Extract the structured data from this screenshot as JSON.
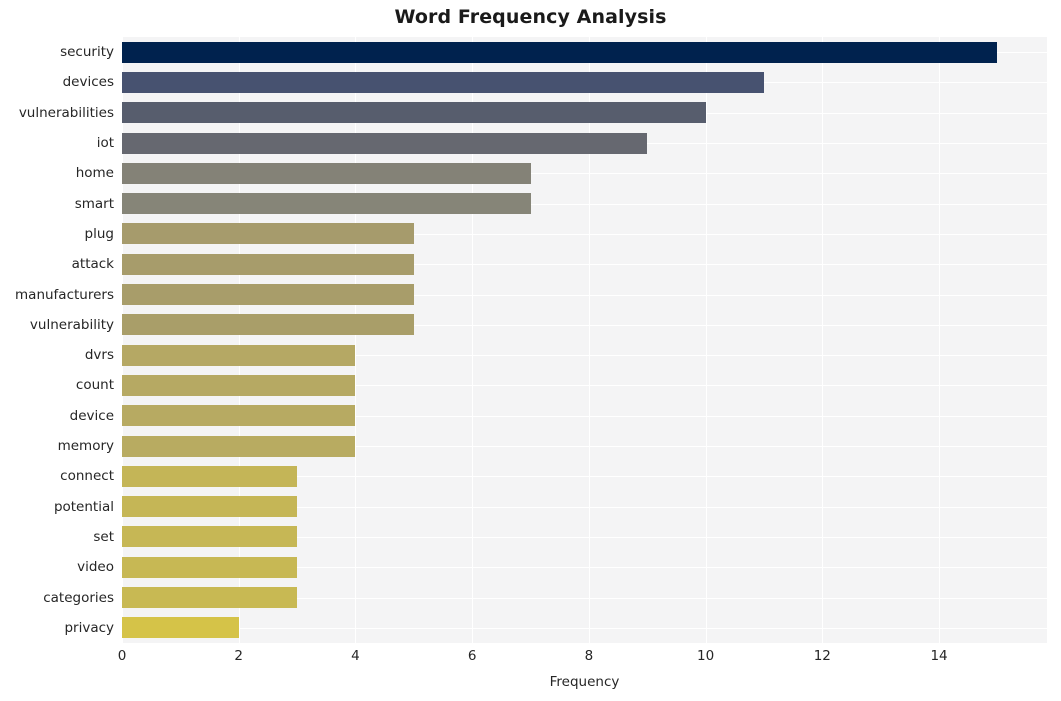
{
  "chart_data": {
    "type": "bar",
    "orientation": "horizontal",
    "title": "Word Frequency Analysis",
    "xlabel": "Frequency",
    "ylabel": "",
    "categories": [
      "security",
      "devices",
      "vulnerabilities",
      "iot",
      "home",
      "smart",
      "plug",
      "attack",
      "manufacturers",
      "vulnerability",
      "dvrs",
      "count",
      "device",
      "memory",
      "connect",
      "potential",
      "set",
      "video",
      "categories",
      "privacy"
    ],
    "values": [
      15,
      11,
      10,
      9,
      7,
      7,
      5,
      5,
      5,
      5,
      4,
      4,
      4,
      4,
      3,
      3,
      3,
      3,
      3,
      2
    ],
    "bar_colors": [
      "#00224e",
      "#475270",
      "#575d6d",
      "#666870",
      "#848277",
      "#868578",
      "#a69b6c",
      "#a79c6b",
      "#a89d6a",
      "#a99e69",
      "#b5a864",
      "#b6a963",
      "#b7aa62",
      "#b8ab61",
      "#c4b557",
      "#c5b656",
      "#c6b755",
      "#c7b854",
      "#c8b953",
      "#d5c348"
    ],
    "xlim": [
      0,
      15.85
    ],
    "xticks": [
      0,
      2,
      4,
      6,
      8,
      10,
      12,
      14
    ],
    "xtick_labels": [
      "0",
      "2",
      "4",
      "6",
      "8",
      "10",
      "12",
      "14"
    ],
    "grid": true,
    "grid_axis": "both",
    "grid_color": "#ffffff",
    "plot_background": "#f4f4f5",
    "figure_background": "#ffffff",
    "legend": null,
    "style": "seaborn-whitegrid",
    "colormap": "cividis"
  }
}
